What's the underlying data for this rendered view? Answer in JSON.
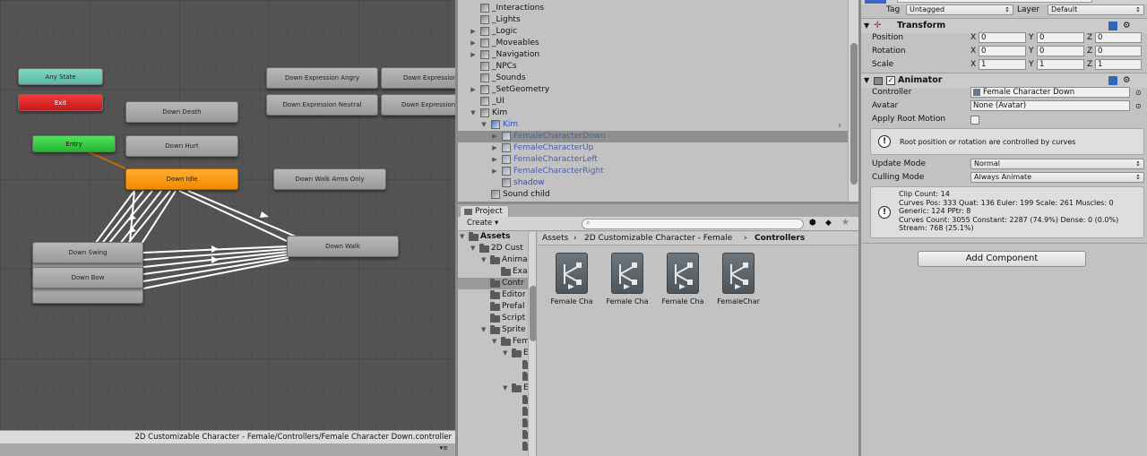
{
  "animator": {
    "states": {
      "any_state": "Any State",
      "exit": "Exit",
      "entry": "Entry",
      "down_death": "Down Death",
      "down_hurt": "Down Hurt",
      "down_idle": "Down Idle",
      "down_expression_angry": "Down Expression Angry",
      "down_expression_2": "Down Expression",
      "down_expression_neutral": "Down Expression Neutral",
      "down_expression_4": "Down Expression Se",
      "down_walk_arms_only": "Down Walk Arms Only",
      "down_walk": "Down Walk",
      "down_swing": "Down Swing",
      "down_bow": "Down Bow"
    },
    "footer_path": "2D Customizable Character - Female/Controllers/Female Character Down.controller"
  },
  "hierarchy": {
    "items": [
      {
        "label": "_Interactions",
        "expand": false,
        "kind": "object"
      },
      {
        "label": "_Lights",
        "expand": false,
        "kind": "object"
      },
      {
        "label": "_Logic",
        "expand": true,
        "kind": "object"
      },
      {
        "label": "_Moveables",
        "expand": true,
        "kind": "object"
      },
      {
        "label": "_Navigation",
        "expand": true,
        "kind": "object"
      },
      {
        "label": "_NPCs",
        "expand": false,
        "kind": "object"
      },
      {
        "label": "_Sounds",
        "expand": false,
        "kind": "object"
      },
      {
        "label": "_SetGeometry",
        "expand": true,
        "kind": "object"
      },
      {
        "label": "_UI",
        "expand": false,
        "kind": "object"
      },
      {
        "label": "Kim",
        "expand": true,
        "kind": "object"
      },
      {
        "label": "Kim",
        "expand": true,
        "kind": "prefab"
      },
      {
        "label": "FemaleCharacterDown",
        "expand": true,
        "kind": "child",
        "selected": true
      },
      {
        "label": "FemaleCharacterUp",
        "expand": true,
        "kind": "child"
      },
      {
        "label": "FemaleCharacterLeft",
        "expand": true,
        "kind": "child"
      },
      {
        "label": "FemaleCharacterRight",
        "expand": true,
        "kind": "child"
      },
      {
        "label": "shadow",
        "expand": false,
        "kind": "prefab-child"
      },
      {
        "label": "Sound child",
        "expand": false,
        "kind": "object"
      }
    ]
  },
  "project": {
    "tab": "Project",
    "create": "Create",
    "tree": [
      {
        "label": "Assets",
        "bold": true,
        "depth": 0
      },
      {
        "label": "2D Cust",
        "depth": 1
      },
      {
        "label": "Anima",
        "depth": 2
      },
      {
        "label": "Exa",
        "depth": 3
      },
      {
        "label": "Contr",
        "depth": 2,
        "selected": true
      },
      {
        "label": "Editor",
        "depth": 2
      },
      {
        "label": "Prefal",
        "depth": 2
      },
      {
        "label": "Script",
        "depth": 2
      },
      {
        "label": "Sprite",
        "depth": 2
      },
      {
        "label": "Fem",
        "depth": 3
      },
      {
        "label": "E",
        "depth": 4
      },
      {
        "label": "",
        "depth": 5
      },
      {
        "label": "",
        "depth": 5
      },
      {
        "label": "E",
        "depth": 4
      },
      {
        "label": "",
        "depth": 5
      },
      {
        "label": "",
        "depth": 5
      },
      {
        "label": "",
        "depth": 5
      },
      {
        "label": "",
        "depth": 5
      },
      {
        "label": "",
        "depth": 5
      }
    ],
    "breadcrumb": {
      "a": "Assets",
      "b": "2D Customizable Character - Female",
      "c": "Controllers"
    },
    "files": [
      "Female Cha",
      "Female Cha",
      "Female Cha",
      "FemaleChar"
    ]
  },
  "inspector": {
    "tag_label": "Tag",
    "tag_value": "Untagged",
    "layer_label": "Layer",
    "layer_value": "Default",
    "transform": {
      "title": "Transform",
      "position": "Position",
      "rotation": "Rotation",
      "scale": "Scale",
      "pos": [
        "0",
        "0",
        "0"
      ],
      "rot": [
        "0",
        "0",
        "0"
      ],
      "scl": [
        "1",
        "1",
        "1"
      ],
      "x": "X",
      "y": "Y",
      "z": "Z"
    },
    "animator": {
      "title": "Animator",
      "controller_label": "Controller",
      "controller_value": "Female Character Down",
      "avatar_label": "Avatar",
      "avatar_value": "None (Avatar)",
      "root_motion_label": "Apply Root Motion",
      "info": "Root position or rotation are controlled by curves",
      "update_mode_label": "Update Mode",
      "update_mode_value": "Normal",
      "culling_label": "Culling Mode",
      "culling_value": "Always Animate",
      "stats": [
        "Clip Count: 14",
        "Curves Pos: 333 Quat: 136 Euler: 199 Scale: 261 Muscles: 0",
        "Generic: 124 PPtr: 8",
        "Curves Count: 3055 Constant: 2287 (74.9%) Dense: 0 (0.0%)",
        "Stream: 768 (25.1%)"
      ]
    },
    "add_component": "Add Component"
  }
}
